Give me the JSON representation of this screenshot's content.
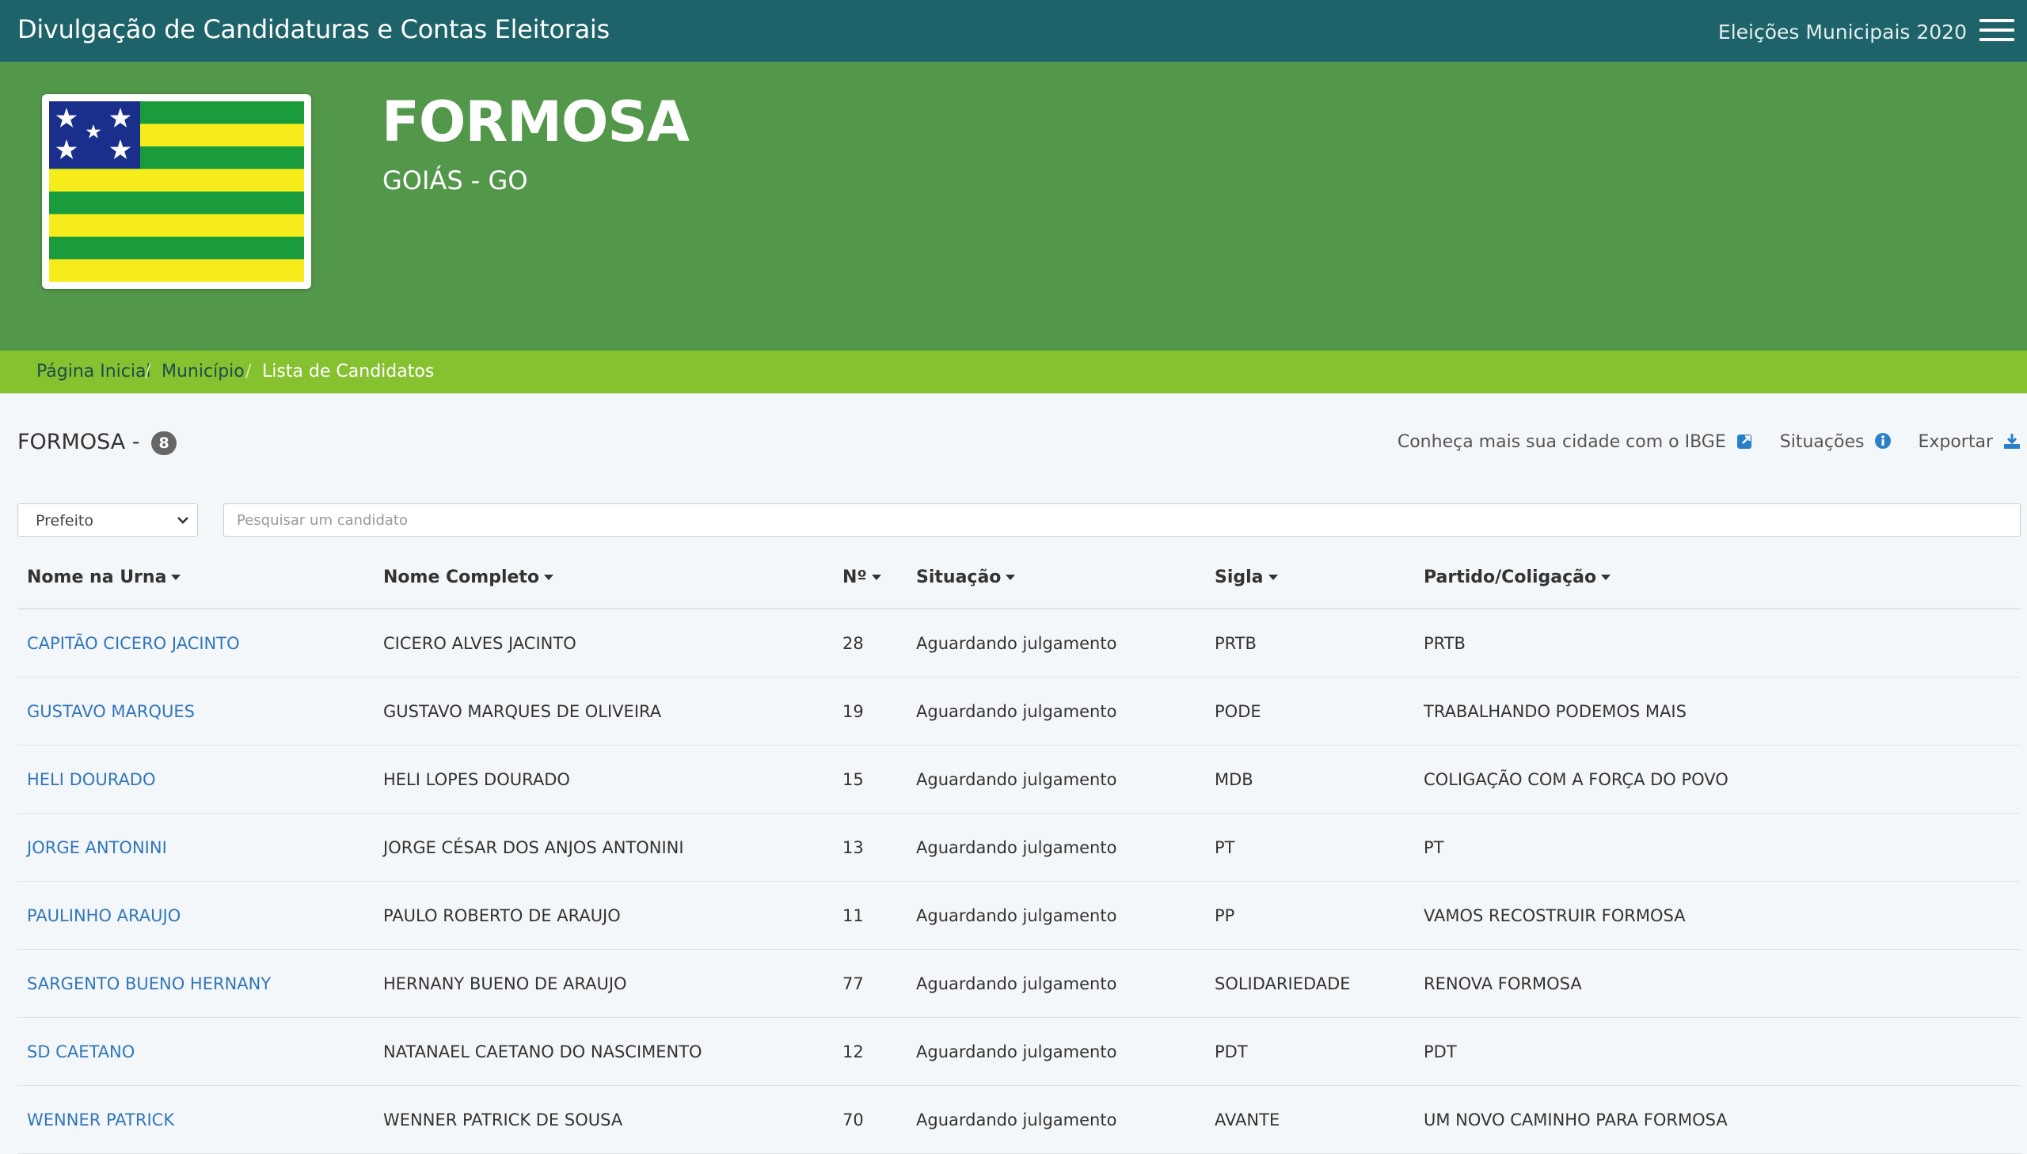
{
  "topbar": {
    "title": "Divulgação de Candidaturas e Contas Eleitorais",
    "election": "Eleições Municipais 2020"
  },
  "hero": {
    "city": "FORMOSA",
    "state": "GOIÁS - GO"
  },
  "breadcrumb": {
    "home": "Página Inicial",
    "municipio": "Município",
    "current": "Lista de Candidatos",
    "separator": "/"
  },
  "list": {
    "city": "FORMOSA",
    "separator": "-",
    "count": "8"
  },
  "tools": {
    "ibge": "Conheça mais sua cidade com o IBGE",
    "situacoes": "Situações",
    "exportar": "Exportar"
  },
  "filters": {
    "cargo": "Prefeito",
    "search_placeholder": "Pesquisar um candidato"
  },
  "columns": {
    "urna": "Nome na Urna",
    "completo": "Nome Completo",
    "numero": "Nº",
    "situacao": "Situação",
    "sigla": "Sigla",
    "partido": "Partido/Coligação"
  },
  "rows": [
    {
      "urna": "CAPITÃO CICERO JACINTO",
      "completo": "CICERO ALVES JACINTO",
      "numero": "28",
      "situacao": "Aguardando julgamento",
      "sigla": "PRTB",
      "partido": "PRTB"
    },
    {
      "urna": "GUSTAVO MARQUES",
      "completo": "GUSTAVO MARQUES DE OLIVEIRA",
      "numero": "19",
      "situacao": "Aguardando julgamento",
      "sigla": "PODE",
      "partido": "TRABALHANDO PODEMOS MAIS"
    },
    {
      "urna": "HELI DOURADO",
      "completo": "HELI LOPES DOURADO",
      "numero": "15",
      "situacao": "Aguardando julgamento",
      "sigla": "MDB",
      "partido": "COLIGAÇÃO COM A FORÇA DO POVO"
    },
    {
      "urna": "JORGE ANTONINI",
      "completo": "JORGE CÉSAR DOS ANJOS ANTONINI",
      "numero": "13",
      "situacao": "Aguardando julgamento",
      "sigla": "PT",
      "partido": "PT"
    },
    {
      "urna": "PAULINHO ARAUJO",
      "completo": "PAULO ROBERTO DE ARAUJO",
      "numero": "11",
      "situacao": "Aguardando julgamento",
      "sigla": "PP",
      "partido": "VAMOS RECOSTRUIR FORMOSA"
    },
    {
      "urna": "SARGENTO BUENO HERNANY",
      "completo": "HERNANY BUENO DE ARAUJO",
      "numero": "77",
      "situacao": "Aguardando julgamento",
      "sigla": "SOLIDARIEDADE",
      "partido": "RENOVA FORMOSA"
    },
    {
      "urna": "SD CAETANO",
      "completo": "NATANAEL CAETANO DO NASCIMENTO",
      "numero": "12",
      "situacao": "Aguardando julgamento",
      "sigla": "PDT",
      "partido": "PDT"
    },
    {
      "urna": "WENNER PATRICK",
      "completo": "WENNER PATRICK DE SOUSA",
      "numero": "70",
      "situacao": "Aguardando julgamento",
      "sigla": "AVANTE",
      "partido": "UM NOVO CAMINHO PARA FORMOSA"
    }
  ],
  "colors": {
    "topbar": "#1e6369",
    "hero": "#52974a",
    "breadcrumb": "#86c12f",
    "link": "#3176b8",
    "flag_green": "#1a9b3c",
    "flag_yellow": "#f6ec1c",
    "flag_blue": "#1a2f8c"
  },
  "icons": {
    "menu": "hamburger-menu-icon",
    "flag": "goias-flag",
    "ibge": "external-link-icon",
    "situacoes": "info-circle-icon",
    "exportar": "download-icon",
    "sort": "caret-down-icon",
    "select": "chevron-down-icon"
  }
}
